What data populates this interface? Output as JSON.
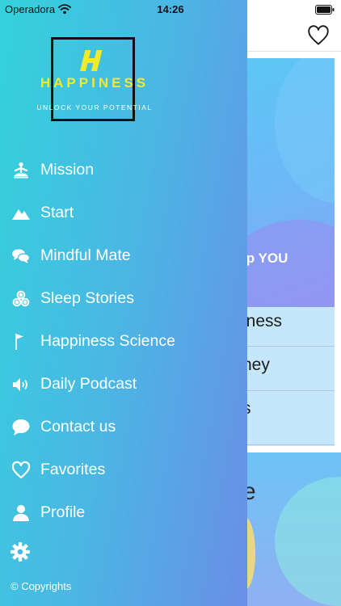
{
  "status_bar": {
    "carrier": "Operadora",
    "time": "14:26",
    "icons": [
      "wifi-icon",
      "battery-icon"
    ]
  },
  "app_screen": {
    "header_icon": "heart-icon",
    "hero_text": "lp YOU",
    "list_rows": [
      "iness",
      "ney",
      "s"
    ],
    "bottom_text": "e"
  },
  "drawer": {
    "logo": {
      "title": "HAPPINESS",
      "tagline": "UNLOCK YOUR POTENTIAL",
      "mark_color": "#f2ea2b"
    },
    "menu": [
      {
        "label": "Mission",
        "icon": "meditation-icon"
      },
      {
        "label": "Start",
        "icon": "mountain-icon"
      },
      {
        "label": "Mindful Mate",
        "icon": "chat-bubbles-icon"
      },
      {
        "label": "Sleep Stories",
        "icon": "triskelion-icon"
      },
      {
        "label": "Happiness Science",
        "icon": "flag-icon"
      },
      {
        "label": "Daily Podcast",
        "icon": "speaker-icon"
      },
      {
        "label": "Contact us",
        "icon": "speech-bubble-icon"
      },
      {
        "label": "Favorites",
        "icon": "heart-outline-icon"
      },
      {
        "label": "Profile",
        "icon": "person-icon"
      }
    ],
    "settings_icon": "gear-icon",
    "copyright": "© Copyrights"
  },
  "colors": {
    "drawer_gradient_start": "#33d2dc",
    "drawer_gradient_end": "#6a8ee6",
    "menu_text": "#ffffff"
  }
}
